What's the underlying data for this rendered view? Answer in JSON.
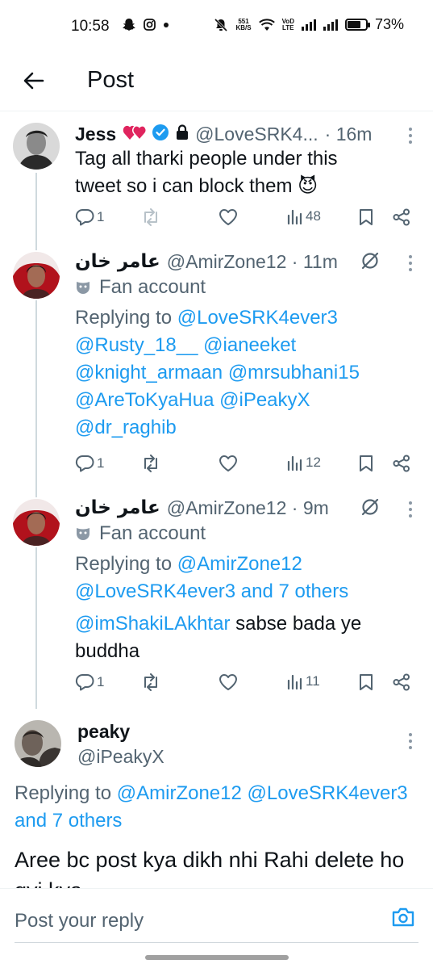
{
  "status_bar": {
    "time": "10:58",
    "net_speed_top": "551",
    "net_speed_bottom": "KB/S",
    "volte_top": "VoD",
    "volte_bottom": "LTE",
    "battery_percent": "73%",
    "battery_level": 0.73
  },
  "header": {
    "title": "Post"
  },
  "tweets": [
    {
      "name": "Jess",
      "handle": "@LoveSRK4...",
      "time": "· 16m",
      "text_line1": "Tag all tharki people under this",
      "text_line2": "tweet so i can block them",
      "emoji": "😈",
      "replies": "1",
      "views": "48"
    },
    {
      "name": "عامر خان",
      "handle": "@AmirZone12 · 11m",
      "label": "Fan account",
      "replying_to": "Replying to",
      "mentions": [
        "@LoveSRK4ever3",
        "@Rusty_18__",
        "@ianeeket",
        "@knight_armaan",
        "@mrsubhani15",
        "@AreToKyaHua",
        "@iPeakyX",
        "@dr_raghib"
      ],
      "replies": "1",
      "views": "12"
    },
    {
      "name": "عامر خان",
      "handle": "@AmirZone12 · 9m",
      "label": "Fan account",
      "replying_to": "Replying to",
      "mention1": "@AmirZone12",
      "mention2": "@LoveSRK4ever3 and 7 others",
      "mention3": "@imShakiLAkhtar",
      "text_after": "sabse bada ye",
      "text_line2": "buddha",
      "replies": "1",
      "views": "11"
    },
    {
      "name": "peaky",
      "handle": "@iPeakyX",
      "replying_to": "Replying to",
      "mention1": "@AmirZone12",
      "mention2": "@LoveSRK4ever3",
      "mention3": "and 7 others",
      "text": "Aree bc post kya dikh nhi Rahi delete ho gyi kya"
    }
  ],
  "reply_bar": {
    "placeholder": "Post your reply"
  },
  "colors": {
    "accent": "#1d9bf0",
    "text": "#0f1419",
    "muted": "#536471"
  }
}
